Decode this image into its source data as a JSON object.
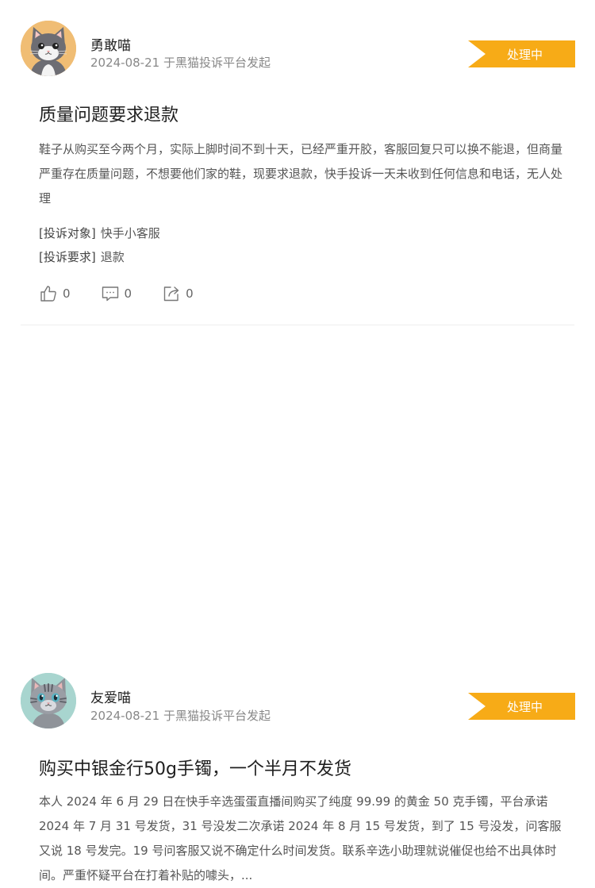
{
  "posts": [
    {
      "username": "勇敢喵",
      "meta": "2024-08-21 于黑猫投诉平台发起",
      "status": "处理中",
      "title": "质量问题要求退款",
      "body": "鞋子从购买至今两个月，实际上脚时间不到十天，已经严重开胶，客服回复只可以换不能退，但商量严重存在质量问题，不想要他们家的鞋，现要求退款，快手投诉一天未收到任何信息和电话，无人处理",
      "target_label": "[投诉对象]",
      "target_value": "快手小客服",
      "request_label": "[投诉要求]",
      "request_value": "退款",
      "likes": "0",
      "comments": "0",
      "shares": "0",
      "avatar_icon": "orange-cat-avatar"
    },
    {
      "username": "友爱喵",
      "meta": "2024-08-21 于黑猫投诉平台发起",
      "status": "处理中",
      "title": "购买中银金行50g手镯，一个半月不发货",
      "body": "本人 2024 年 6 月 29 日在快手辛选蛋蛋直播间购买了纯度 99.99 的黄金 50 克手镯，平台承诺 2024 年 7 月 31 号发货，31 号没发二次承诺 2024 年 8 月 15 号发货，到了 15 号没发，问客服又说 18 号发完。19 号问客服又说不确定什么时间发货。联系辛选小助理就说催促也给不出具体时间。严重怀疑平台在打着补贴的噱头，...",
      "avatar_icon": "grey-tabby-cat-avatar"
    }
  ],
  "colors": {
    "badge": "#f7ab17",
    "meta_text": "#888888",
    "body_text": "#555555"
  },
  "icons": [
    "thumbs-up-icon",
    "comment-icon",
    "share-icon"
  ]
}
